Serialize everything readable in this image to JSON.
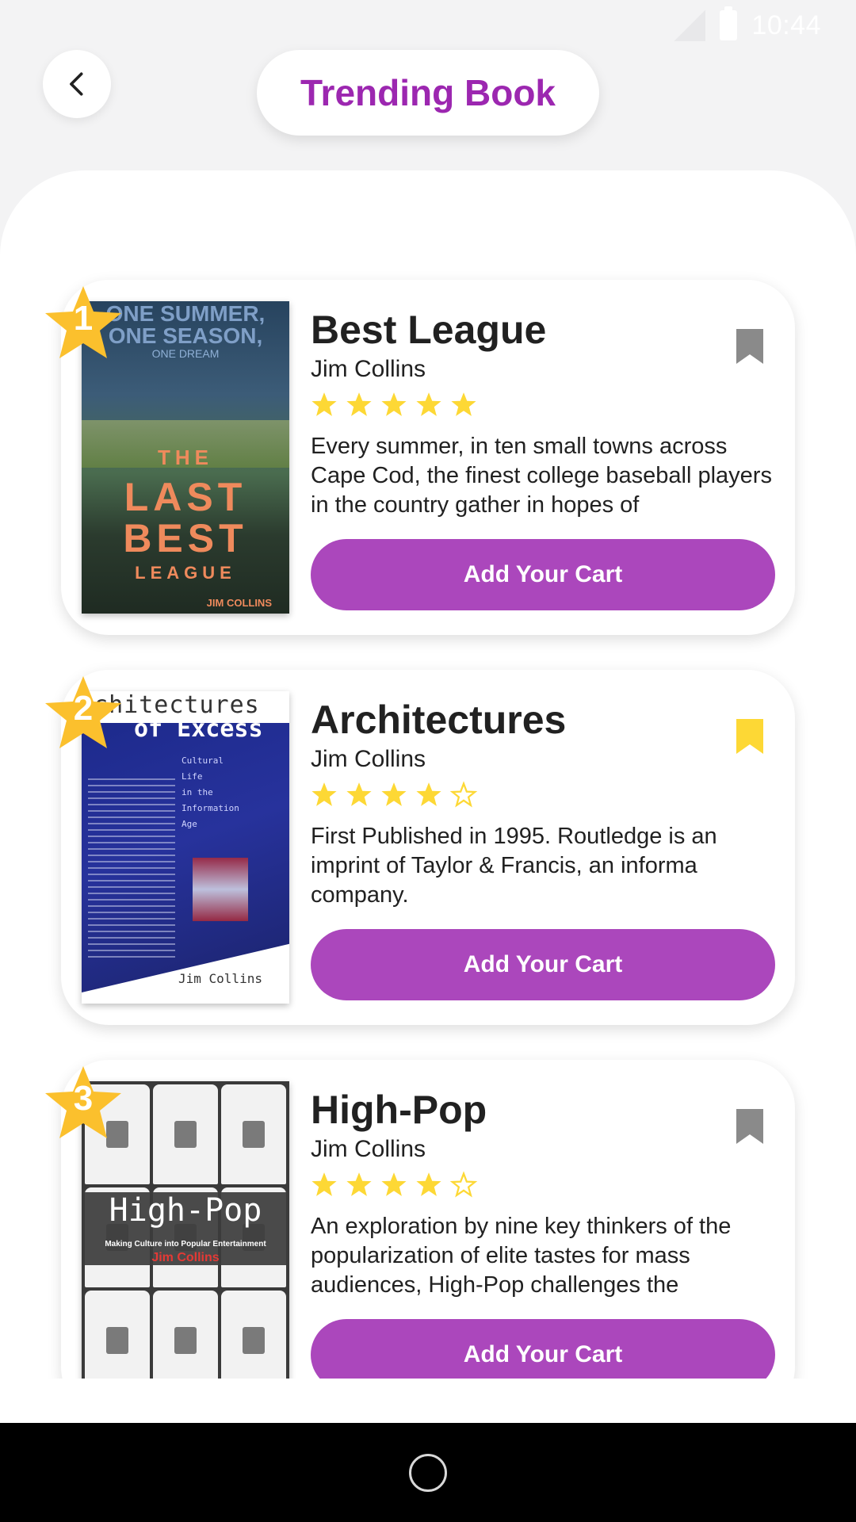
{
  "status_bar": {
    "time": "10:44"
  },
  "header": {
    "title": "Trending Book"
  },
  "books": [
    {
      "rank": "1",
      "title": "Best League",
      "author": "Jim Collins",
      "rating": 5,
      "description": "Every summer, in ten small towns across Cape Cod, the finest college baseball players in the country gather in hopes of",
      "bookmarked": false,
      "cart_label": "Add Your Cart",
      "cover": {
        "top": "ONE SUMMER, ONE SEASON,",
        "small": "ONE DREAM",
        "line1": "THE",
        "line2": "LAST",
        "line3": "BEST",
        "line4": "LEAGUE",
        "author": "JIM COLLINS"
      }
    },
    {
      "rank": "2",
      "title": "Architectures",
      "author": "Jim Collins",
      "rating": 4,
      "description": "First Published in 1995. Routledge is an imprint of Taylor & Francis, an informa company.",
      "bookmarked": true,
      "cart_label": "Add Your Cart",
      "cover": {
        "head1": "rchitectures",
        "head2": "of Excess",
        "sub": "Cultural\nLife\nin the\nInformation\nAge",
        "author": "Jim Collins"
      }
    },
    {
      "rank": "3",
      "title": "High-Pop",
      "author": "Jim Collins",
      "rating": 4,
      "description": "An exploration by nine key thinkers of the popularization of elite tastes for mass audiences, High-Pop challenges the",
      "bookmarked": false,
      "cart_label": "Add Your Cart",
      "cover": {
        "title": "High-Pop",
        "sub": "Making Culture into Popular Entertainment",
        "editor": "Jim Collins"
      }
    }
  ],
  "colors": {
    "accent": "#9c27b0",
    "button": "#ab47bc",
    "star": "#fdd835",
    "badge": "#fbc02d",
    "bookmark_off": "#8a8a8a",
    "bookmark_on": "#fdd835"
  },
  "icons": [
    "back-arrow-icon",
    "signal-icon",
    "battery-icon",
    "star-icon",
    "bookmark-icon",
    "home-button-icon"
  ]
}
